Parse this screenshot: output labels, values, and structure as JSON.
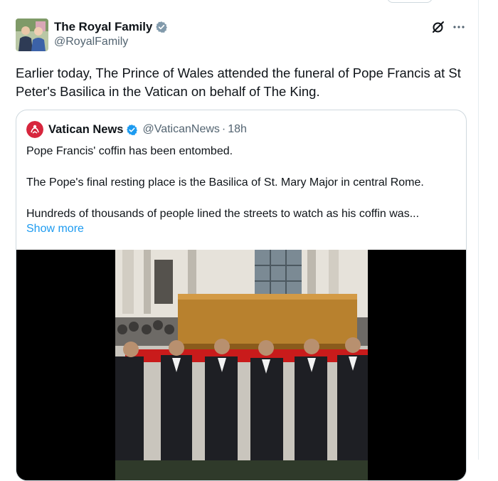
{
  "author": {
    "display_name": "The Royal Family",
    "handle": "@RoyalFamily",
    "verified_color": "#829aab"
  },
  "tweet": {
    "text": "Earlier today, The Prince of Wales attended the funeral of Pope Francis at St Peter's Basilica in the Vatican on behalf of The King."
  },
  "quoted": {
    "display_name": "Vatican News",
    "handle": "@VaticanNews",
    "separator": "·",
    "time": "18h",
    "verified_color": "#1d9bf0",
    "paragraphs": [
      "Pope Francis' coffin has been entombed.",
      "The Pope's final resting place is the Basilica of St. Mary Major in central Rome.",
      "Hundreds of thousands of people lined the streets to watch as his coffin was..."
    ],
    "show_more_label": "Show more"
  },
  "icons": {
    "grok": "grok-icon",
    "more": "more-icon",
    "verified": "verified-badge-icon"
  },
  "colors": {
    "link": "#1d9bf0",
    "secondary_text": "#536471",
    "border": "#cfd9de"
  }
}
